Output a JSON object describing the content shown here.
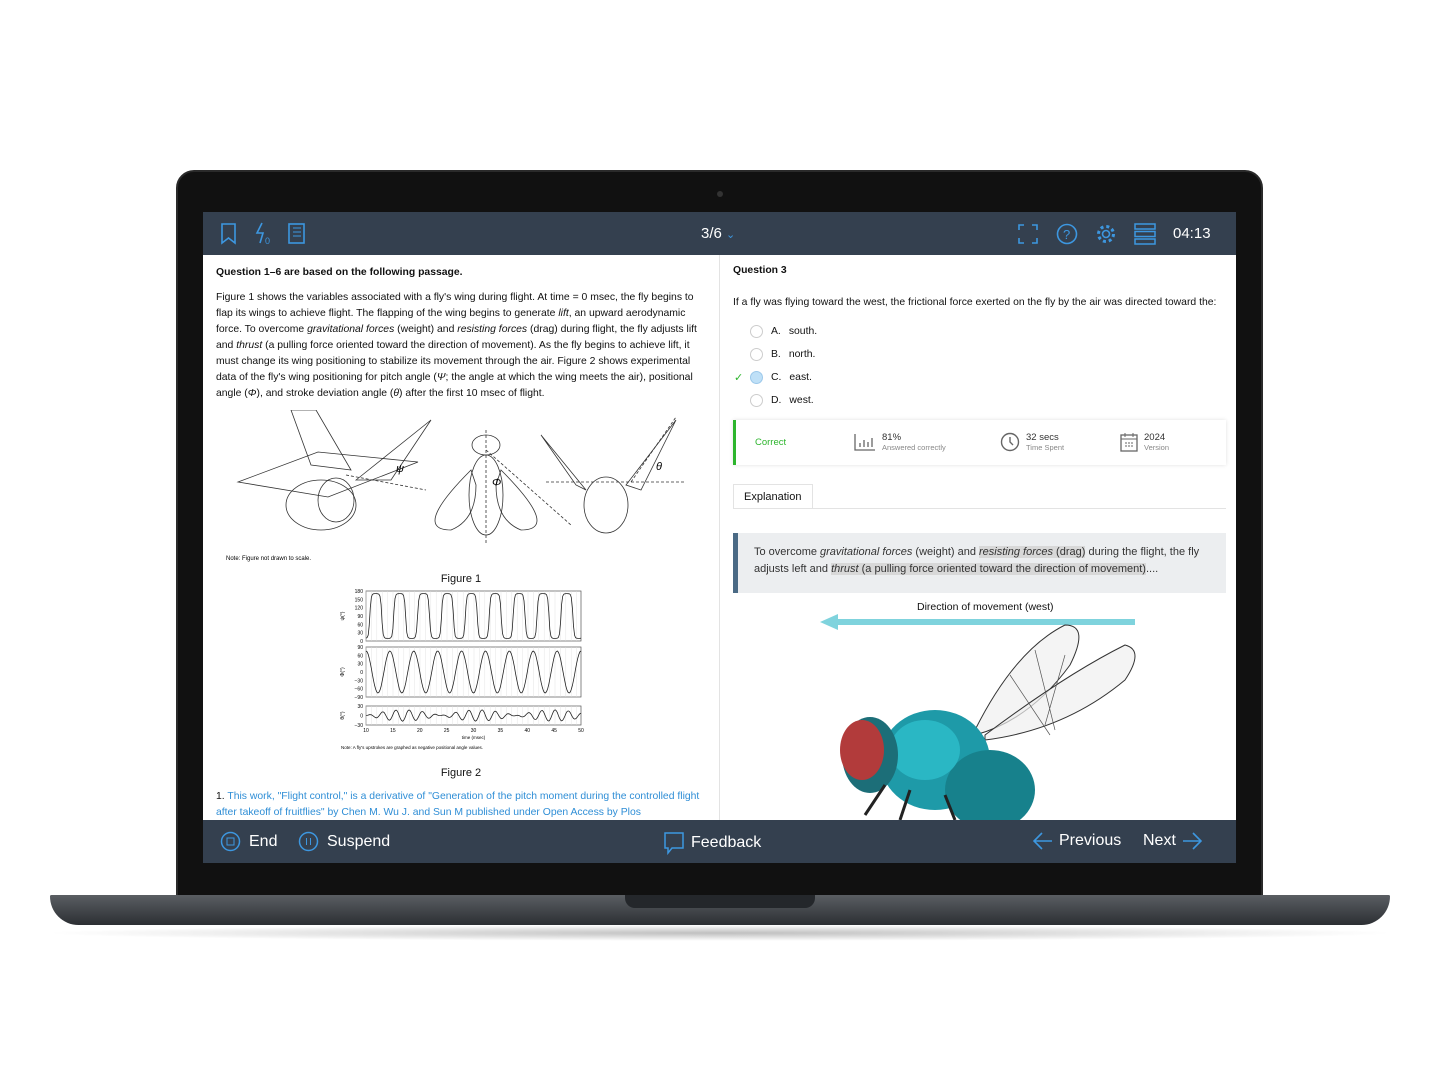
{
  "header": {
    "progress": "3/6",
    "timer": "04:13",
    "left_icons": [
      "bookmark-icon",
      "percent-icon",
      "notebook-icon"
    ],
    "right_icons": [
      "fullscreen-icon",
      "help-icon",
      "settings-icon",
      "layout-icon"
    ]
  },
  "passage": {
    "heading": "Question 1–6 are based on the following passage.",
    "paragraph": [
      {
        "t": "Figure 1 shows the variables associated with a fly's wing during flight.  At time = 0 msec, the fly begins to flap its wings to achieve flight.  The flapping of the wing begins to generate "
      },
      {
        "i": "lift"
      },
      {
        "t": ", an upward aerodynamic force.  To overcome "
      },
      {
        "i": "gravitational forces"
      },
      {
        "t": " (weight) and "
      },
      {
        "i": "resisting forces"
      },
      {
        "t": " (drag) during flight, the fly adjusts lift and "
      },
      {
        "i": "thrust"
      },
      {
        "t": " (a pulling force oriented toward the direction of movement).  As the fly begins to achieve lift, it must change its wing positioning to stabilize its movement through the air.  Figure 2 shows experimental data of the fly's wing positioning for pitch angle ("
      },
      {
        "i": "Ψ"
      },
      {
        "t": "; the angle at which the wing meets the air), positional angle ("
      },
      {
        "i": "Φ"
      },
      {
        "t": "), and stroke deviation angle ("
      },
      {
        "i": "θ"
      },
      {
        "t": ") after the first 10 msec of flight."
      }
    ],
    "figure1": {
      "note": "Note: Figure not drawn to scale.",
      "caption": "Figure 1",
      "labels": [
        "ψ",
        "Φ",
        "θ"
      ]
    },
    "figure2": {
      "caption": "Figure 2",
      "note": "Note: A fly's upstrokes are graphed as negative positional angle values.",
      "xlabel": "time (msec)",
      "xticks": [
        "10",
        "15",
        "20",
        "25",
        "30",
        "35",
        "40",
        "45",
        "50"
      ],
      "panels": [
        {
          "ylabel": "ψ(°)",
          "yticks": [
            "180",
            "150",
            "120",
            "90",
            "60",
            "30",
            "0"
          ]
        },
        {
          "ylabel": "Φ(°)",
          "yticks": [
            "90",
            "60",
            "30",
            "0",
            "−30",
            "−60",
            "−90"
          ]
        },
        {
          "ylabel": "θ(°)",
          "yticks": [
            "30",
            "0",
            "−30"
          ]
        }
      ]
    },
    "footnote_num": "1.",
    "footnote": "This work, \"Flight control,\" is a derivative of \"Generation of the pitch moment during the controlled flight after takeoff of fruitflies\" by Chen M. Wu J. and Sun M published under Open Access by Plos"
  },
  "question": {
    "title": "Question 3",
    "stem": "If a fly was flying toward the west, the frictional force exerted on the fly by the air was directed toward the:",
    "choices": [
      {
        "letter": "A.",
        "text": "south."
      },
      {
        "letter": "B.",
        "text": "north."
      },
      {
        "letter": "C.",
        "text": "east.",
        "selected": true,
        "correct": true
      },
      {
        "letter": "D.",
        "text": "west."
      }
    ]
  },
  "result": {
    "status": "Correct",
    "percent": "81%",
    "percent_label": "Answered correctly",
    "time": "32 secs",
    "time_label": "Time Spent",
    "version": "2024",
    "version_label": "Version",
    "accent": "#2db52d"
  },
  "explanation": {
    "tab": "Explanation",
    "parts": [
      {
        "t": "To overcome "
      },
      {
        "i": "gravitational forces"
      },
      {
        "t": " (weight) and "
      },
      {
        "h": "resisting forces"
      },
      {
        "h2": " (drag)"
      },
      {
        "t": " during the flight, the fly adjusts left and "
      },
      {
        "h": "thrust"
      },
      {
        "h2": " (a pulling force oriented toward the direction of movement)"
      },
      {
        "t": "...."
      }
    ],
    "illustration_label": "Direction of movement (west)"
  },
  "footer": {
    "end": "End",
    "suspend": "Suspend",
    "feedback": "Feedback",
    "previous": "Previous",
    "next": "Next"
  },
  "colors": {
    "bar": "#34404f",
    "icon": "#3d97e0",
    "link": "#2f8ed6",
    "arrow": "#7fd3dd"
  }
}
